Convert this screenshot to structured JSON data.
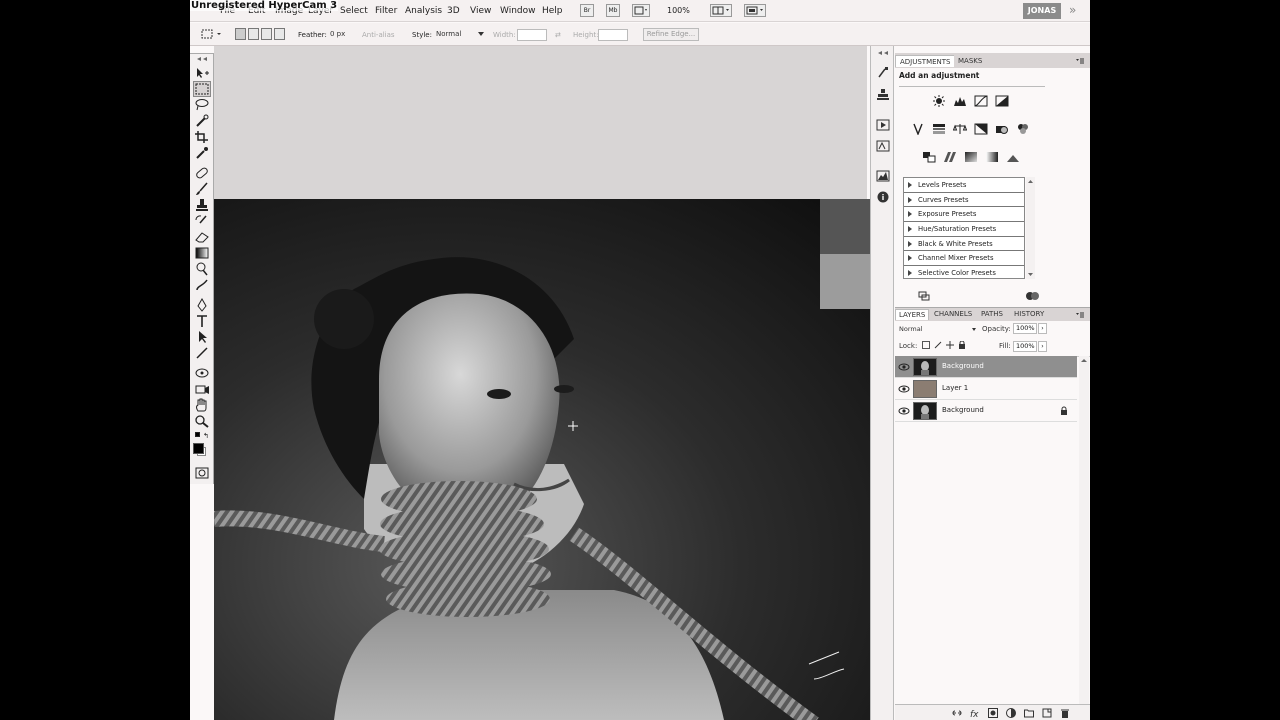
{
  "watermark": "Unregistered HyperCam 3",
  "menubar": {
    "items": [
      "File",
      "Edit",
      "Image",
      "Layer",
      "Select",
      "Filter",
      "Analysis",
      "3D",
      "View",
      "Window",
      "Help"
    ],
    "br_label": "Br",
    "mb_label": "Mb",
    "zoom": "100%",
    "workspace": "JONAS",
    "more": "»"
  },
  "options": {
    "feather_label": "Feather:",
    "feather_value": "0 px",
    "antialias_label": "Anti-alias",
    "style_label": "Style:",
    "style_value": "Normal",
    "width_label": "Width:",
    "height_label": "Height:",
    "refine_label": "Refine Edge..."
  },
  "adjustments": {
    "tabs": [
      "ADJUSTMENTS",
      "MASKS"
    ],
    "title": "Add an adjustment",
    "presets": [
      "Levels Presets",
      "Curves Presets",
      "Exposure Presets",
      "Hue/Saturation Presets",
      "Black & White Presets",
      "Channel Mixer Presets",
      "Selective Color Presets"
    ]
  },
  "layers": {
    "tabs": [
      "LAYERS",
      "CHANNELS",
      "PATHS",
      "HISTORY"
    ],
    "blend_mode": "Normal",
    "opacity_label": "Opacity:",
    "opacity_value": "100%",
    "lock_label": "Lock:",
    "fill_label": "Fill:",
    "fill_value": "100%",
    "rows": [
      {
        "name": "Background",
        "selected": true,
        "locked": false
      },
      {
        "name": "Layer 1",
        "selected": false,
        "locked": false
      },
      {
        "name": "Background",
        "selected": false,
        "locked": true
      }
    ]
  },
  "colors": {
    "foreground": "#000000",
    "background": "#ffffff",
    "selected_layer": "#8f8f8f",
    "layer1_thumb": "#8b7d72"
  }
}
